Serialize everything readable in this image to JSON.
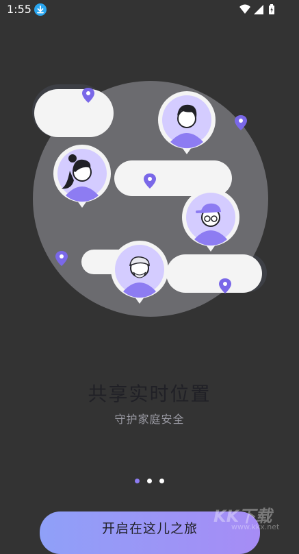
{
  "status_bar": {
    "time": "1:55",
    "icons": [
      "download-icon",
      "wifi-icon",
      "signal-icon",
      "battery-icon"
    ]
  },
  "onboarding": {
    "title": "共享实时位置",
    "subtitle": "守护家庭安全",
    "pager": {
      "pages": 3,
      "current": 1
    },
    "start_button_label": "开启在这儿之旅"
  },
  "watermark": {
    "main": "KK下载",
    "sub": "www.kkx.net"
  },
  "colors": {
    "background": "#333333",
    "accent": "#8d7cf2",
    "button_gradient_start": "#8fa0f8",
    "button_gradient_end": "#a68cf5",
    "globe": "#6b6b6f",
    "title_text": "#202026",
    "subtitle_text": "#9a9aa3"
  }
}
